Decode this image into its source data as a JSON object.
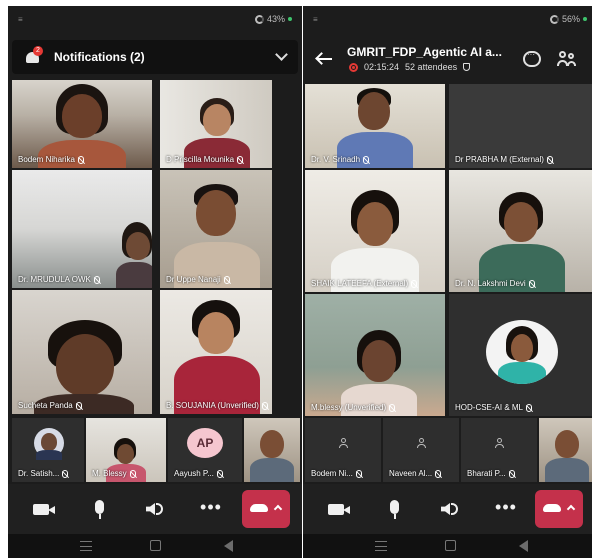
{
  "left_screen": {
    "status": {
      "battery": "43%"
    },
    "notifications": {
      "title": "Notifications (2)",
      "badge_count": "2"
    },
    "tiles": [
      {
        "name": "Bodem Niharika"
      },
      {
        "name": "D Priscilla Mounika"
      },
      {
        "name": "Dr. MRUDULA OWK"
      },
      {
        "name": "Dr Uppe Nanaji"
      },
      {
        "name": "Sucheta Panda"
      },
      {
        "name": "B. SOUJANIA  (Unverified)"
      }
    ],
    "strip": [
      {
        "name": "Dr. Satish..."
      },
      {
        "name": "M. Blessy"
      },
      {
        "name": "Aayush P...",
        "initials": "AP"
      },
      {
        "name": ""
      }
    ]
  },
  "right_screen": {
    "status": {
      "battery": "56%"
    },
    "meeting": {
      "title": "GMRIT_FDP_Agentic AI a...",
      "duration": "02:15:24",
      "attendees": "52 attendees"
    },
    "tiles": [
      {
        "name": "Dr. V. Srinadh"
      },
      {
        "name": "Dr PRABHA M (External)"
      },
      {
        "name": "SHAIK LATEEFA (External)"
      },
      {
        "name": "Dr. N. Lakshmi Devi"
      },
      {
        "name": "M.blessy (Unverified)"
      },
      {
        "name": "HOD-CSE-AI & ML"
      }
    ],
    "strip": [
      {
        "name": "Bodem Ni..."
      },
      {
        "name": "Naveen Al..."
      },
      {
        "name": "Bharati P..."
      },
      {
        "name": ""
      }
    ]
  },
  "icons": [
    "bell-icon",
    "chevron-down-icon",
    "back-arrow-icon",
    "chat-icon",
    "people-icon",
    "camera-icon",
    "microphone-icon",
    "speaker-icon",
    "more-icon",
    "hang-up-icon",
    "mic-muted-icon",
    "record-icon",
    "shield-icon"
  ],
  "colors": {
    "hang_up": "#c4314b",
    "active_speaker_border": "#8c8cff",
    "notification_badge": "#e53935",
    "record": "#e53935",
    "background": "#1c1c1c"
  }
}
